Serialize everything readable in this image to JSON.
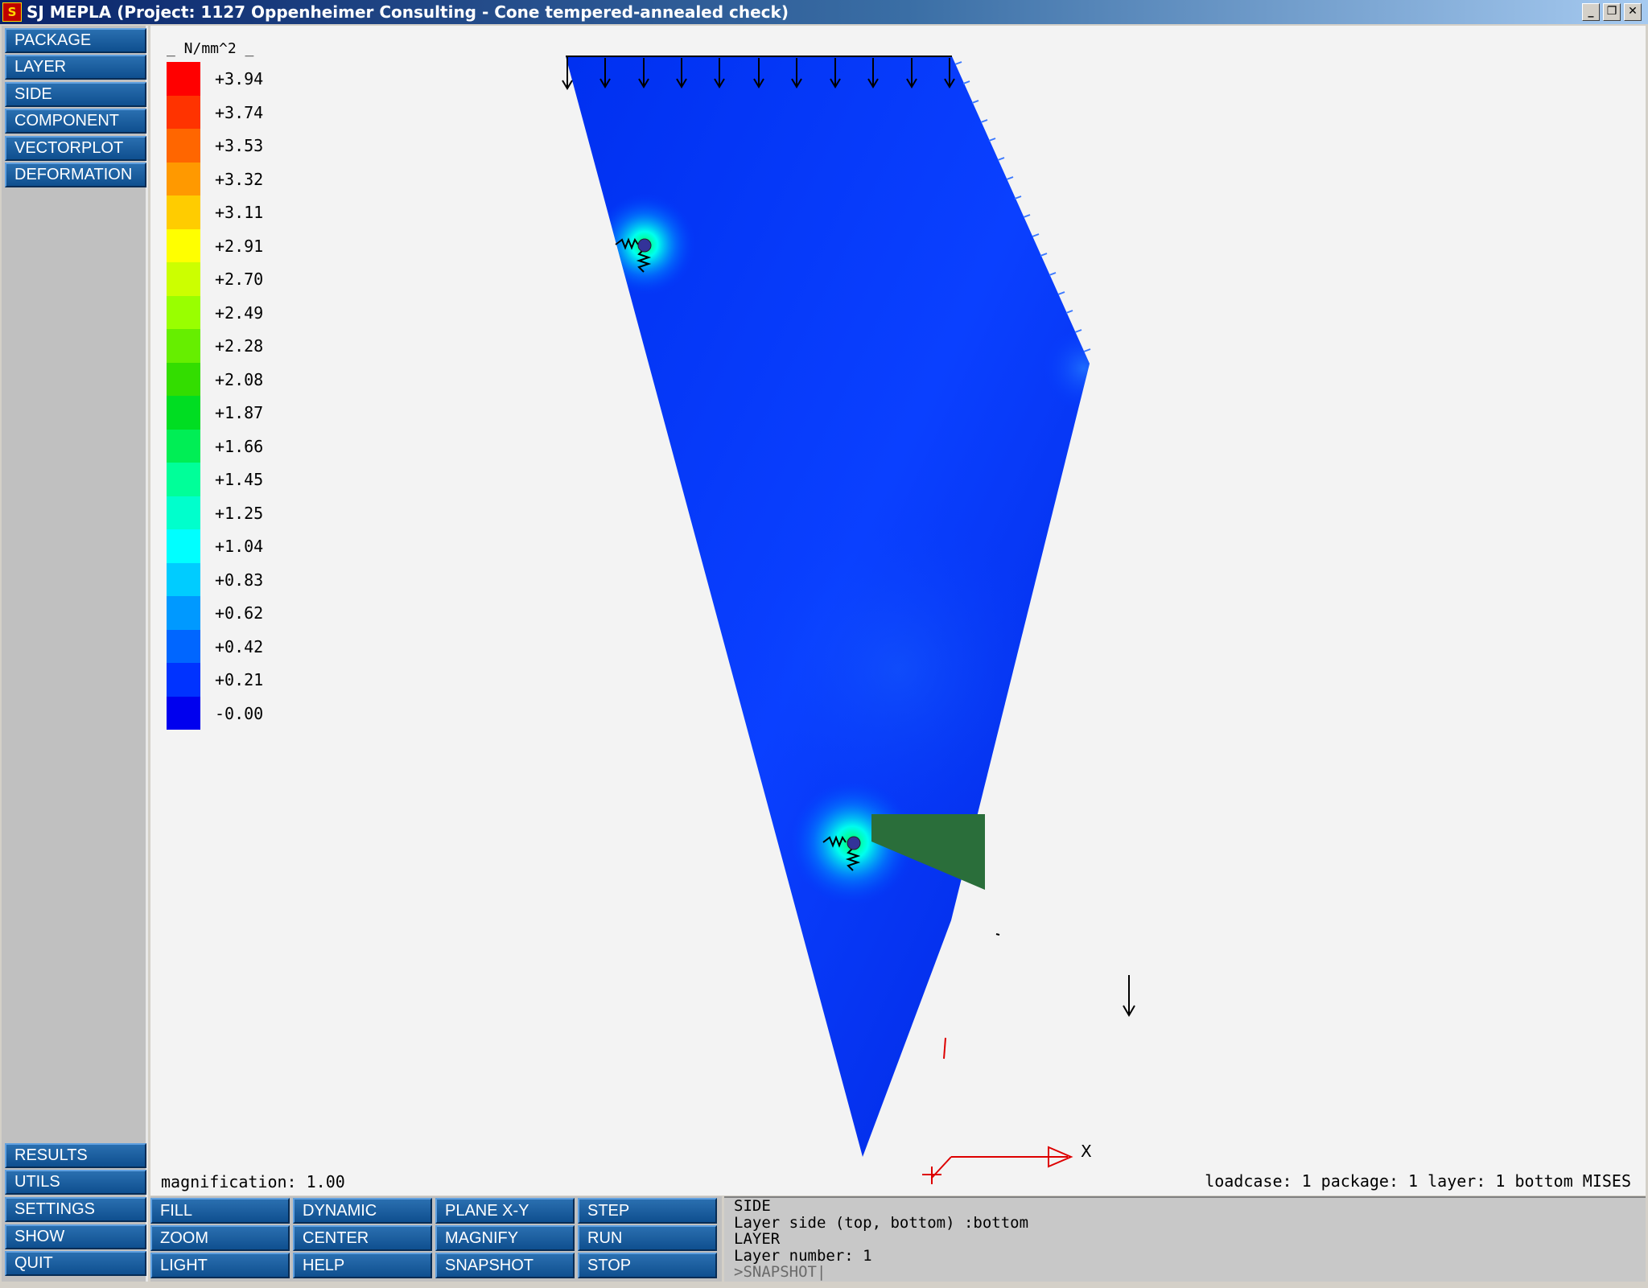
{
  "window": {
    "app_icon_letter": "S",
    "title": "SJ MEPLA (Project: 1127 Oppenheimer Consulting - Cone tempered-annealed check)",
    "minimize": "_",
    "restore": "❐",
    "close": "✕"
  },
  "left_menu": {
    "top_items": [
      "PACKAGE",
      "LAYER",
      "SIDE",
      "COMPONENT",
      "VECTORPLOT",
      "DEFORMATION"
    ],
    "bottom_items": [
      "RESULTS",
      "UTILS",
      "SETTINGS",
      "SHOW",
      "QUIT"
    ]
  },
  "toolbar": {
    "columns": [
      [
        "FILL",
        "ZOOM",
        "LIGHT"
      ],
      [
        "DYNAMIC",
        "CENTER",
        "HELP"
      ],
      [
        "PLANE X-Y",
        "MAGNIFY",
        "SNAPSHOT"
      ],
      [
        "STEP",
        "RUN",
        "STOP"
      ]
    ]
  },
  "legend": {
    "unit_label": "_ N/mm^2 _",
    "labels": [
      "+3.94",
      "+3.74",
      "+3.53",
      "+3.32",
      "+3.11",
      "+2.91",
      "+2.70",
      "+2.49",
      "+2.28",
      "+2.08",
      "+1.87",
      "+1.66",
      "+1.45",
      "+1.25",
      "+1.04",
      "+0.83",
      "+0.62",
      "+0.42",
      "+0.21",
      "-0.00"
    ],
    "colors": [
      "#ff0000",
      "#ff3300",
      "#ff6600",
      "#ff9900",
      "#ffcc00",
      "#ffff00",
      "#ccff00",
      "#99ff00",
      "#66ee00",
      "#33dd00",
      "#00dd22",
      "#00ee55",
      "#00ff99",
      "#00ffcc",
      "#00ffff",
      "#00ccff",
      "#0099ff",
      "#0066ff",
      "#0033ff",
      "#0000ee"
    ]
  },
  "viewport": {
    "magnification_label": "magnification:  1.00",
    "loadcase_label": "loadcase:  1 package: 1 layer: 1 bottom MISES",
    "axis_x_label": "X"
  },
  "console": {
    "lines": [
      "SIDE",
      "Layer side (top, bottom) :bottom",
      "LAYER",
      "Layer number: 1"
    ],
    "input": ">SNAPSHOT|"
  }
}
